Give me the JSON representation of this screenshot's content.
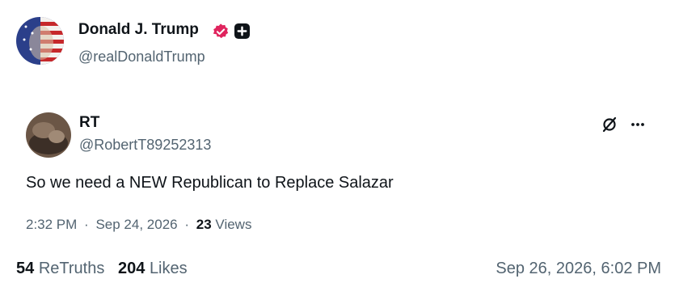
{
  "author": {
    "display_name": "Donald J. Trump",
    "handle": "@realDonaldTrump",
    "avatar_icon": "flag-face-avatar",
    "verified_icon": "verified-badge-icon",
    "verified_color": "#e0245e"
  },
  "retruth": {
    "display_name": "RT",
    "handle": "@RobertT89252313",
    "text": "So we need a NEW Republican to Replace Salazar",
    "time": "2:32 PM",
    "date": "Sep 24, 2026",
    "separator": "·",
    "views_count": "23",
    "views_label": "Views"
  },
  "stats": {
    "retruths_count": "54",
    "retruths_label": "ReTruths",
    "likes_count": "204",
    "likes_label": "Likes",
    "shared_timestamp": "Sep 26, 2026, 6:02 PM"
  },
  "colors": {
    "text_primary": "#0f1419",
    "text_secondary": "#536471"
  }
}
